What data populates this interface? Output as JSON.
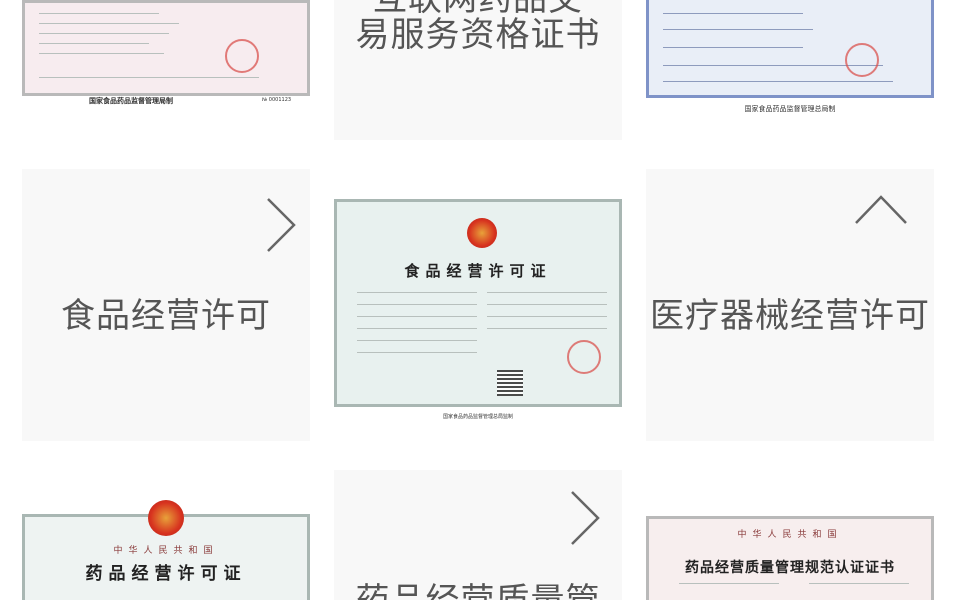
{
  "tiles": {
    "internet_drug": {
      "label_line1": "互联网药品交",
      "label_line2": "易服务资格证书"
    },
    "food_license": {
      "label": "食品经营许可"
    },
    "medical_device": {
      "label": "医疗器械经营许可"
    },
    "gsp": {
      "label_partial": "药品经营质量管"
    }
  },
  "certificates": {
    "top_left": {
      "footer": "国家食品药品监督管理局制",
      "number": "№ 0001123"
    },
    "top_right": {
      "footer": "国家食品药品监督管理总局制"
    },
    "food_cert": {
      "title": "食品经营许可证",
      "footer": "国家食品药品监督管理总局监制"
    },
    "drug_cert": {
      "top": "中华人民共和国",
      "title": "药品经营许可证"
    },
    "gsp_cert": {
      "top": "中华人民共和国",
      "title": "药品经营质量管理规范认证证书"
    }
  },
  "colors": {
    "tile_bg": "#f8f8f8",
    "text": "#555555",
    "arrow": "#666666"
  },
  "icons": {
    "next": "chevron-right-icon",
    "top": "chevron-up-icon"
  }
}
